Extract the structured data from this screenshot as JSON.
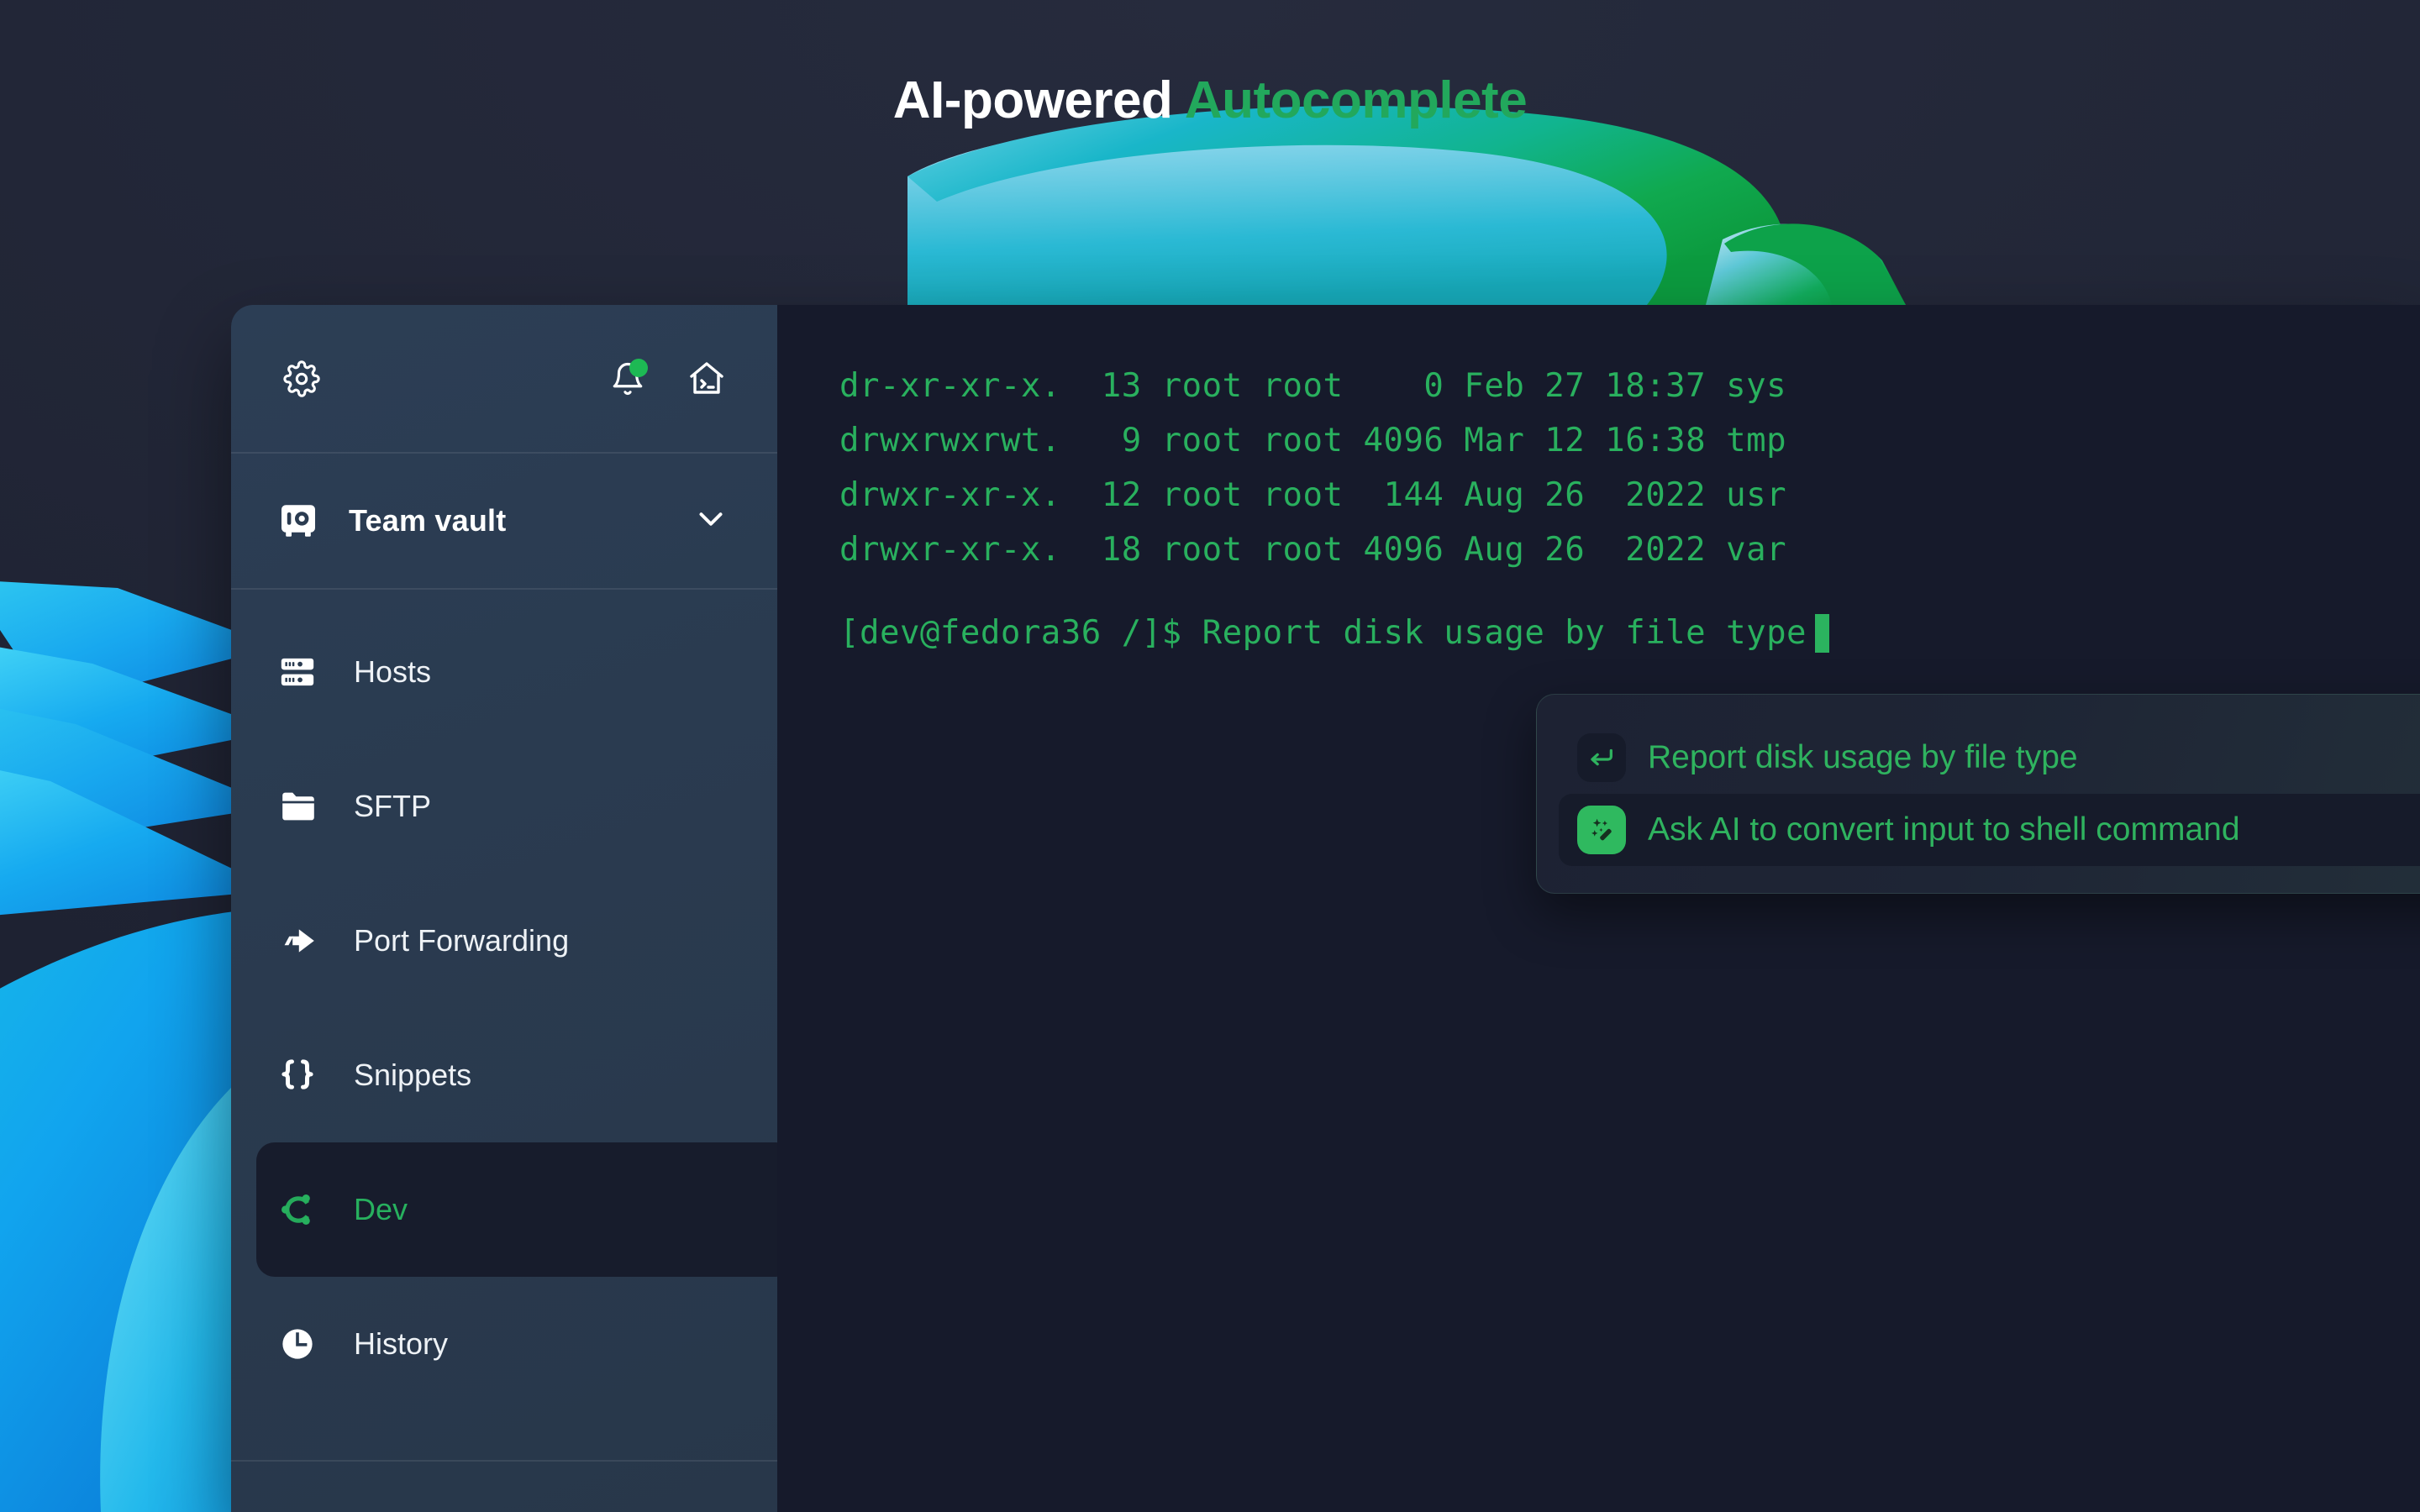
{
  "headline": {
    "prefix": "AI-powered",
    "accent": "Autocomplete"
  },
  "colors": {
    "accent_green": "#22a85c",
    "terminal_green": "#29b05e",
    "sidebar_bg": "#2a3b50",
    "terminal_bg": "#161a2b",
    "page_bg": "#232737",
    "active_item_bg": "#171c2c",
    "badge_green": "#1db954"
  },
  "sidebar": {
    "toolbar": {
      "settings_icon": "gear-icon",
      "notifications_icon": "bell-icon",
      "notifications_badge": true,
      "home_terminal_icon": "home-terminal-icon"
    },
    "vault": {
      "icon": "vault-icon",
      "label": "Team vault",
      "chevron": "chevron-down-icon"
    },
    "items": [
      {
        "label": "Hosts",
        "icon": "server-rack-icon",
        "active": false
      },
      {
        "label": "SFTP",
        "icon": "folder-icon",
        "active": false
      },
      {
        "label": "Port Forwarding",
        "icon": "forward-arrow-icon",
        "active": false
      },
      {
        "label": "Snippets",
        "icon": "curly-braces-icon",
        "active": false
      },
      {
        "label": "Dev",
        "icon": "ubuntu-icon",
        "active": true
      },
      {
        "label": "History",
        "icon": "clock-icon",
        "active": false
      }
    ]
  },
  "terminal": {
    "lines": [
      "dr-xr-xr-x.  13 root root    0 Feb 27 18:37 sys",
      "drwxrwxrwt.   9 root root 4096 Mar 12 16:38 tmp",
      "drwxr-xr-x.  12 root root  144 Aug 26  2022 usr",
      "drwxr-xr-x.  18 root root 4096 Aug 26  2022 var"
    ],
    "prompt": "[dev@fedora36 /]$ ",
    "input": "Report disk usage by file type",
    "cursor": "block-caret"
  },
  "autocomplete": {
    "items": [
      {
        "label": "Report disk usage by file type",
        "icon": "enter-return-icon",
        "icon_style": "dark",
        "selected": false
      },
      {
        "label": "Ask AI to convert input to shell command",
        "icon": "magic-wand-icon",
        "icon_style": "green",
        "selected": true
      }
    ]
  }
}
